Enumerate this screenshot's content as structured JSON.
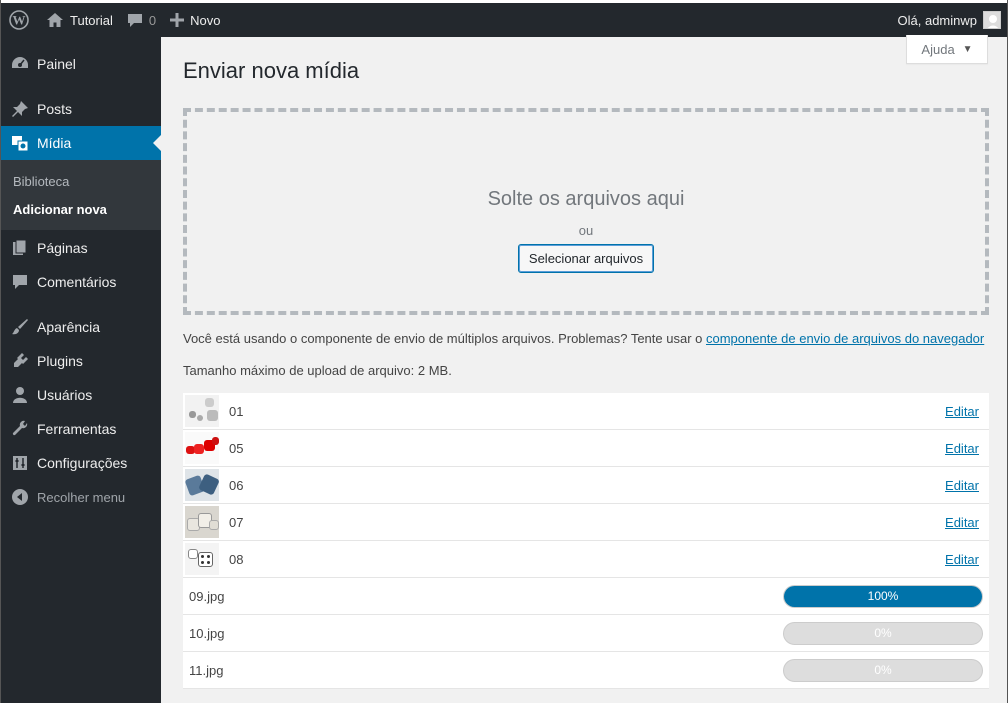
{
  "adminbar": {
    "wp_logo_icon": "wordpress-logo-icon",
    "site_name": "Tutorial",
    "comments_count": "0",
    "new_label": "Novo",
    "greeting": "Olá, adminwp"
  },
  "sidebar": {
    "items": [
      {
        "label": "Painel",
        "icon": "dashboard-icon"
      },
      {
        "label": "Posts",
        "icon": "pin-icon"
      },
      {
        "label": "Mídia",
        "icon": "media-icon"
      },
      {
        "label": "Páginas",
        "icon": "pages-icon"
      },
      {
        "label": "Comentários",
        "icon": "comments-icon"
      },
      {
        "label": "Aparência",
        "icon": "appearance-icon"
      },
      {
        "label": "Plugins",
        "icon": "plugins-icon"
      },
      {
        "label": "Usuários",
        "icon": "users-icon"
      },
      {
        "label": "Ferramentas",
        "icon": "tools-icon"
      },
      {
        "label": "Configurações",
        "icon": "settings-icon"
      }
    ],
    "submenu": [
      "Biblioteca",
      "Adicionar nova"
    ],
    "collapse_label": "Recolher menu"
  },
  "help_tab": "Ajuda",
  "page_title": "Enviar nova mídia",
  "drop_area": {
    "drop_text": "Solte os arquivos aqui",
    "or_text": "ou",
    "select_button": "Selecionar arquivos"
  },
  "uploader_info": {
    "text": "Você está usando o componente de envio de múltiplos arquivos. Problemas? Tente usar o ",
    "link": "componente de envio de arquivos do navegador"
  },
  "max_size": "Tamanho máximo de upload de arquivo: 2 MB.",
  "media_items": [
    {
      "title": "01",
      "edit": "Editar"
    },
    {
      "title": "05",
      "edit": "Editar"
    },
    {
      "title": "06",
      "edit": "Editar"
    },
    {
      "title": "07",
      "edit": "Editar"
    },
    {
      "title": "08",
      "edit": "Editar"
    }
  ],
  "pending_items": [
    {
      "filename": "09.jpg",
      "progress_label": "100%",
      "progress": 1.0
    },
    {
      "filename": "10.jpg",
      "progress_label": "0%",
      "progress": 0.0
    },
    {
      "filename": "11.jpg",
      "progress_label": "0%",
      "progress": 0.0
    }
  ],
  "colors": {
    "accent": "#0073aa",
    "sidebar_bg": "#23282d",
    "submenu_bg": "#32373c"
  }
}
